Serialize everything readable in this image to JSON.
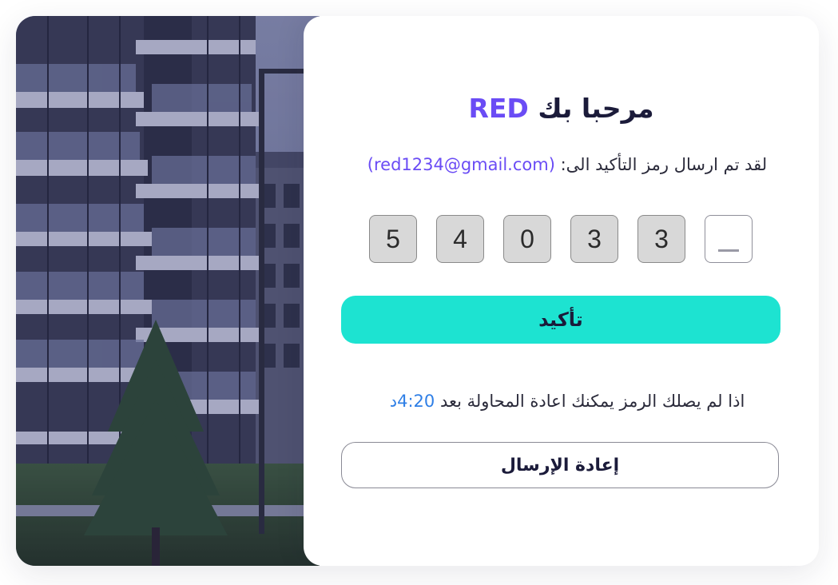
{
  "header": {
    "greeting": "مرحبا بك",
    "brand": "RED"
  },
  "message": {
    "text": "لقد تم ارسال رمز التأكيد الى:",
    "email": "(red1234@gmail.com)"
  },
  "otp": {
    "digits": [
      "",
      "3",
      "3",
      "0",
      "4",
      "5"
    ]
  },
  "confirm_button": {
    "label": "تأكيد"
  },
  "resend": {
    "note": "اذا لم يصلك الرمز يمكنك اعادة المحاولة بعد",
    "timer": "4:20د",
    "button_label": "إعادة الإرسال"
  },
  "colors": {
    "brand": "#6a4cf5",
    "accent": "#1de3d1",
    "timer": "#2f7fe6",
    "text": "#1b1b3a"
  }
}
